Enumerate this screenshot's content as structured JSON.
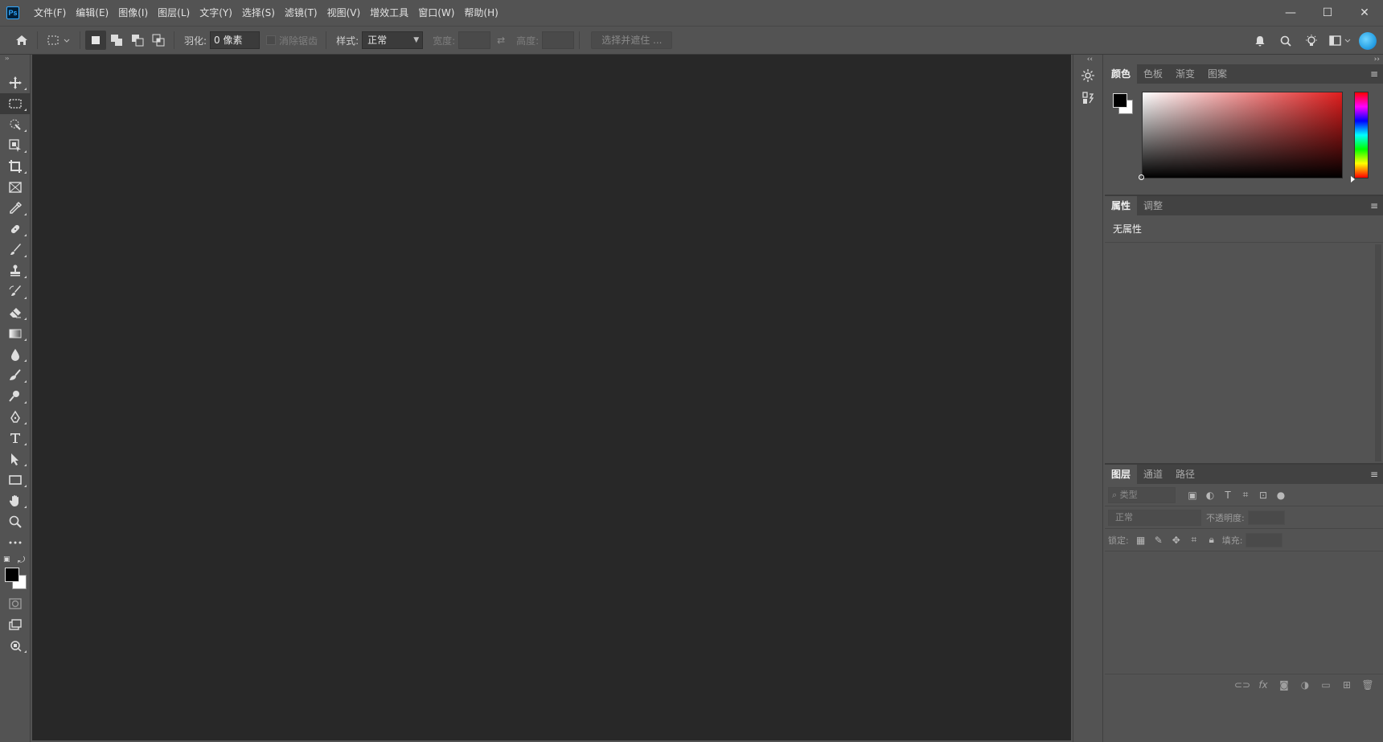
{
  "app": {
    "logo_text": "Ps",
    "menu": [
      "文件(F)",
      "编辑(E)",
      "图像(I)",
      "图层(L)",
      "文字(Y)",
      "选择(S)",
      "滤镜(T)",
      "视图(V)",
      "增效工具",
      "窗口(W)",
      "帮助(H)"
    ],
    "window_controls": {
      "minimize": "—",
      "maximize": "☐",
      "close": "✕"
    }
  },
  "options": {
    "feather_label": "羽化:",
    "feather_value": "0 像素",
    "antialias_label": "消除锯齿",
    "style_label": "样式:",
    "style_value": "正常",
    "width_label": "宽度:",
    "height_label": "高度:",
    "select_mask_button": "选择并遮住 ..."
  },
  "toolbar": {
    "active_tool": "rectangular-marquee",
    "foreground_color": "#000000",
    "background_color": "#ffffff"
  },
  "panels": {
    "color_group": {
      "tabs": [
        "颜色",
        "色板",
        "渐变",
        "图案"
      ],
      "active_tab": "颜色",
      "hue_color": "#e01e1e"
    },
    "properties_group": {
      "tabs": [
        "属性",
        "调整"
      ],
      "active_tab": "属性",
      "empty_text": "无属性"
    },
    "layers_group": {
      "tabs": [
        "图层",
        "通道",
        "路径"
      ],
      "active_tab": "图层",
      "filter_placeholder": "类型",
      "blend_mode": "正常",
      "opacity_label": "不透明度:",
      "lock_label": "锁定:",
      "fill_label": "填充:"
    }
  },
  "colors": {
    "canvas_bg": "#282828",
    "ui_bg": "#535353",
    "accent": "#31a8ff"
  }
}
